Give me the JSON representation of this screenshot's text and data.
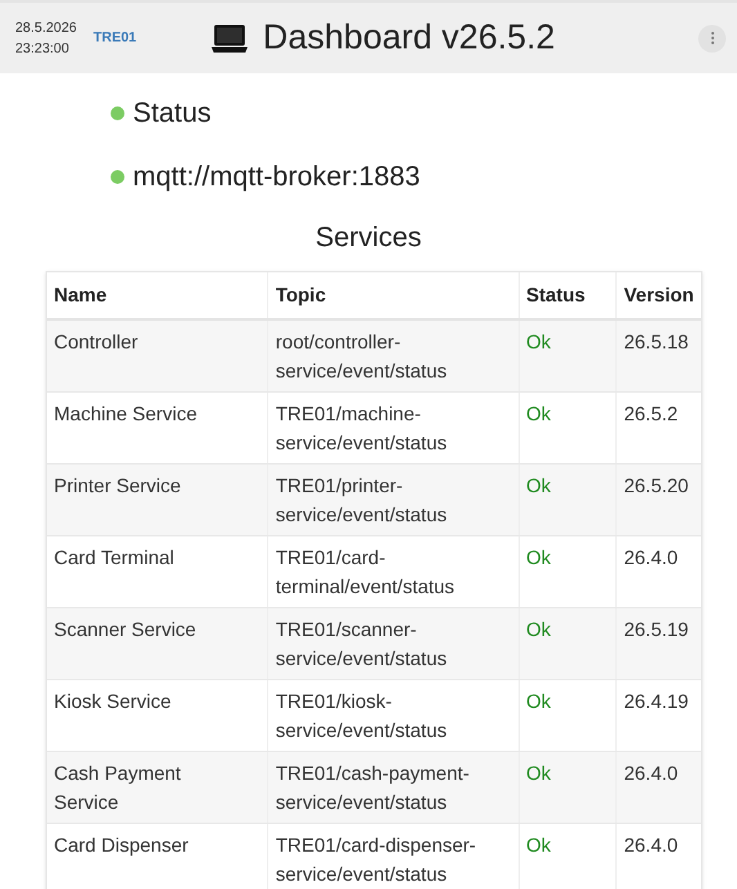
{
  "header": {
    "date": "28.5.2026",
    "time": "23:23:00",
    "site": "TRE01",
    "title": "Dashboard v26.5.2"
  },
  "indicators": [
    {
      "label": "Status",
      "color": "#7ccc63"
    },
    {
      "label": "mqtt://mqtt-broker:1883",
      "color": "#7ccc63"
    }
  ],
  "services": {
    "title": "Services",
    "columns": [
      "Name",
      "Topic",
      "Status",
      "Version"
    ],
    "rows": [
      {
        "name": "Controller",
        "topic": "root/controller-service/event/status",
        "status": "Ok",
        "version": "26.5.18"
      },
      {
        "name": "Machine Service",
        "topic": "TRE01/machine-service/event/status",
        "status": "Ok",
        "version": "26.5.2"
      },
      {
        "name": "Printer Service",
        "topic": "TRE01/printer-service/event/status",
        "status": "Ok",
        "version": "26.5.20"
      },
      {
        "name": "Card Terminal",
        "topic": "TRE01/card-terminal/event/status",
        "status": "Ok",
        "version": "26.4.0"
      },
      {
        "name": "Scanner Service",
        "topic": "TRE01/scanner-service/event/status",
        "status": "Ok",
        "version": "26.5.19"
      },
      {
        "name": "Kiosk Service",
        "topic": "TRE01/kiosk-service/event/status",
        "status": "Ok",
        "version": "26.4.19"
      },
      {
        "name": "Cash Payment Service",
        "topic": "TRE01/cash-payment-service/event/status",
        "status": "Ok",
        "version": "26.4.0"
      },
      {
        "name": "Card Dispenser",
        "topic": "TRE01/card-dispenser-service/event/status",
        "status": "Ok",
        "version": "26.4.0"
      }
    ]
  }
}
